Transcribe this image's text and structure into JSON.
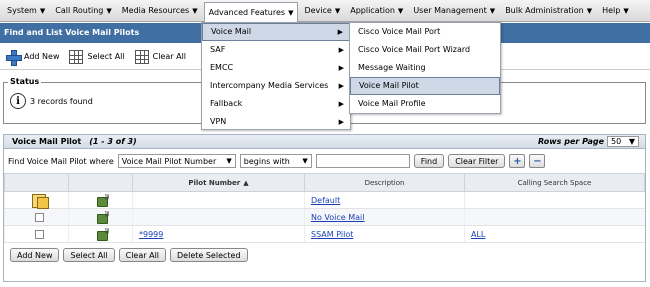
{
  "menubar": {
    "items": [
      {
        "label": "System"
      },
      {
        "label": "Call Routing"
      },
      {
        "label": "Media Resources"
      },
      {
        "label": "Advanced Features"
      },
      {
        "label": "Device"
      },
      {
        "label": "Application"
      },
      {
        "label": "User Management"
      },
      {
        "label": "Bulk Administration"
      },
      {
        "label": "Help"
      }
    ],
    "caret": "▼"
  },
  "page": {
    "title": "Find and List Voice Mail Pilots"
  },
  "toolbar": {
    "add_new": "Add New",
    "select_all": "Select All",
    "clear_all": "Clear All"
  },
  "status": {
    "legend": "Status",
    "icon": "info-icon",
    "message": "3 records found"
  },
  "panel": {
    "title": "Voice Mail Pilot",
    "count": "(1 - 3 of 3)",
    "rows_per_page_label": "Rows per Page",
    "rows_per_page_value": "50"
  },
  "find": {
    "prefix": "Find Voice Mail Pilot where",
    "field": "Voice Mail Pilot Number",
    "operator": "begins with",
    "value": "",
    "find_button": "Find",
    "clear_filter_button": "Clear Filter",
    "plus": "+",
    "minus": "−"
  },
  "table": {
    "headers": [
      "",
      "",
      "Pilot Number",
      "Description",
      "Calling Search Space"
    ],
    "sort_indicator": "▲",
    "rows": [
      {
        "pilot_number": "",
        "description": "Default",
        "css": ""
      },
      {
        "pilot_number": "",
        "description": "No Voice Mail",
        "css": ""
      },
      {
        "pilot_number": "*9999",
        "description": "SSAM Pilot",
        "css": "ALL"
      }
    ]
  },
  "bottom": {
    "add_new": "Add New",
    "select_all": "Select All",
    "clear_all": "Clear All",
    "delete_selected": "Delete Selected"
  },
  "advanced_menu": {
    "items": [
      {
        "label": "Voice Mail",
        "submenu": true
      },
      {
        "label": "SAF",
        "submenu": true
      },
      {
        "label": "EMCC",
        "submenu": true
      },
      {
        "label": "Intercompany Media Services",
        "submenu": true
      },
      {
        "label": "Fallback",
        "submenu": true
      },
      {
        "label": "VPN",
        "submenu": true
      }
    ],
    "arrow": "▶"
  },
  "voicemail_menu": {
    "items": [
      {
        "label": "Cisco Voice Mail Port"
      },
      {
        "label": "Cisco Voice Mail Port Wizard"
      },
      {
        "label": "Message Waiting"
      },
      {
        "label": "Voice Mail Pilot"
      },
      {
        "label": "Voice Mail Profile"
      }
    ]
  }
}
